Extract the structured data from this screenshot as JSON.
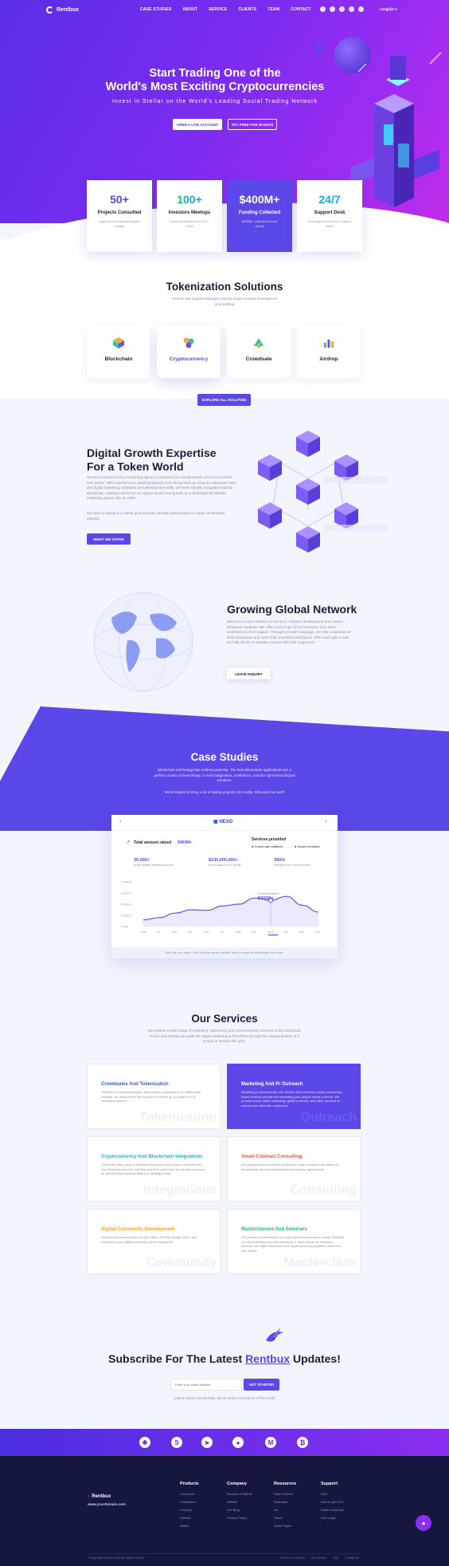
{
  "brand": {
    "name": "Rentbux"
  },
  "nav": {
    "items": [
      "CASE STUDIES",
      "ABOUT",
      "SERVICE",
      "CLIENTS",
      "TEAM",
      "CONTACT"
    ],
    "language": "English"
  },
  "hero": {
    "title_line1": "Start Trading One of the",
    "title_line2": "World's Most Exciting Cryptocurrencies",
    "subtitle": "Invest in Stellar on the World's Leading Social Trading Network",
    "btn_primary": "OPEN A LIVE ACCOUNT",
    "btn_secondary": "TRY FREE FOR 30-DAYS"
  },
  "stats": [
    {
      "value": "50+",
      "label": "Projects Consulted",
      "desc": "Apply for an expertise project review"
    },
    {
      "value": "100+",
      "label": "Investors Meetups",
      "desc": "Investors Meetups in 2017-2018"
    },
    {
      "value": "$400M+",
      "label": "Funding Collected",
      "desc": "$400M+ collected for our clients"
    },
    {
      "value": "24/7",
      "label": "Support Desk",
      "desc": "Full support 24 hours 7 days a week"
    }
  ],
  "tokenization": {
    "title": "Tokenization Solutions",
    "text": "All technical support packages include smart contract development and auditing",
    "items": [
      "Blockchain",
      "Cryptocurrency",
      "Crowdsale",
      "Airdrop"
    ],
    "button": "EXPLORE ALL SOLUTION"
  },
  "growth": {
    "title_line1": "Digital Growth Expertise",
    "title_line2": "For a Token World",
    "p1": "We are a cryptocurrency marketing agency constructed by entrepreneurs who know to build and market. With experience in growing Startups from the ground up using our advanced SEO and digital marketing strategies and development skills, we have robustly navigated towards Blockchain, Startups and ICO's to support launch and growth as a dedicated Blockchain marketing agency like no other.",
    "p2": "Our love of seeing our clients grow ensures ultimate performance in a time constrained industry.",
    "button": "WHAT WE OFFER"
  },
  "network": {
    "title": "Growing Global Network",
    "text": "We focus on pre-market ICO services, software development and custom Ethereum solutions. We offer a full scope of ICO services, from seed investment to ICO support. Throughout each campaign, we help companies to build awareness and reach their potential contributors. After each sale is over, we help clients to maintain contact with their supporters.",
    "button": "LEAVE INQUIRY"
  },
  "case_studies": {
    "title": "Case Studies",
    "text": "Blockchain technology has endless potential. The best Blockchain applications are a perfect combo of three things: A vivid imagination, confidence, and the right technological solutions.",
    "text2": "We've helped to bring a lot of daring projects into reality. Will yours be next?",
    "project": "NEXO",
    "card": {
      "total_label": "Total amount raised",
      "total_value": "$400M+",
      "services_label": "Services provided",
      "services": [
        "Crowd sale platform",
        "Smart contracts"
      ],
      "metrics": [
        {
          "value": "30,000+",
          "label": "active register investor accounts"
        },
        {
          "value": "$130,000,000+",
          "label": "funds raised by our clients"
        },
        {
          "value": "340%",
          "label": "average return on investment"
        }
      ],
      "tooltip_label": "Amount raised",
      "tooltip_value": "$400M+",
      "footer": "Don't sell your crypto. Don't lose the upside potential. Keep it and get an instant loan from Nexo."
    }
  },
  "chart_data": {
    "type": "area",
    "x": [
      "2016",
      "Jul",
      "Nov",
      "Apr",
      "2017",
      "Jul",
      "Sept",
      "Nov",
      "2018",
      "Jan",
      "Mar",
      "Oct"
    ],
    "yticks": [
      "$ 400 M",
      "$ 300 M",
      "$ 200 M",
      "$ 100 M",
      "$ 0 M"
    ],
    "ylim": [
      0,
      400
    ],
    "values": [
      60,
      80,
      120,
      150,
      145,
      185,
      200,
      255,
      235,
      270,
      190,
      130
    ]
  },
  "services": {
    "title": "Our Services",
    "text": "We provide a wide range of marketing, advertising and communication services in the blockchain sector and thereby we guide the digital marketing & PR efforts through the varying phases of a project or service life cycle.",
    "items": [
      {
        "title": "Crowdsales And Tokenization",
        "desc": "Whether it's concept analysis, token launch preparation, or white paper creation: we assist in the development of viable go-to projects for a successful launch.",
        "watermark": "Tokenization",
        "color": "#3a5ad9"
      },
      {
        "title": "Marketing And Pr Outreach",
        "desc": "Marketing is fundamental. Our service and extensive crypto community-based network provide the marketing your project needs to thrive. We provide social media marketing, global outreach, and other services to connect you best with customers.",
        "watermark": "Outreach",
        "color": "#ffffff"
      },
      {
        "title": "Cryptocurrency And Blockchain Integrations",
        "desc": "There are many ways to integrate blockchain and crypto currencies into your business process. We help you find a lead start on the new economy by defining and implementing your strategy today.",
        "watermark": "Integrations",
        "color": "#16b6c9"
      },
      {
        "title": "Smart Contract Consulting",
        "desc": "We analyze business needs to develop smart contract code based to decentralize financial transactions and service agreements.",
        "watermark": "Consulting",
        "color": "#e8563a"
      },
      {
        "title": "Digital Community Development",
        "desc": "Independent communities are the future. We help design, build, and implement your digital community to be trustworthy.",
        "watermark": "Community",
        "color": "#f0a32a"
      },
      {
        "title": "Masterclasses And Seminars",
        "desc": "We provide masterclasses on crypto-precious and block chains. Whether you are interested in public speaking or more hands on education process, we make blockchain and crypto currency programs tailored to your needs.",
        "watermark": "Masterclass",
        "color": "#2bb673"
      }
    ]
  },
  "subscribe": {
    "title_pre": "Subscribe For The Latest",
    "title_brand": "Rentbux",
    "title_post": "Updates!",
    "placeholder": "Enter your email address",
    "button": "GET STARTED",
    "note": "Latest news in blockchain, bitcoin and e-commerce of the world"
  },
  "footer": {
    "brand": "Rentbux",
    "url": "www.yourdomain.com",
    "columns": [
      {
        "title": "Products",
        "items": [
          "Consumer",
          "Commerce",
          "Custody",
          "Pamela",
          "Wallet"
        ]
      },
      {
        "title": "Company",
        "items": [
          "Become a Partner",
          "Affiliate",
          "Our Blog",
          "Privacy Policy"
        ]
      },
      {
        "title": "Resources",
        "items": [
          "How It Works",
          "Roadmap",
          "Ico",
          "Token",
          "White Paper"
        ]
      },
      {
        "title": "Support",
        "items": [
          "FAQ",
          "How to get ETH",
          "What is Airdrop?",
          "Give angel"
        ]
      }
    ],
    "copyright": "© Copyright Rentbux 2018. All rights reserved",
    "legal": [
      "Terms & Conditions",
      "Our Partners",
      "FAQ",
      "Contact Us"
    ]
  },
  "colors": {
    "brand": "#5a48e8",
    "hero_start": "#5b2ee6",
    "hero_end": "#c12de9",
    "footer_bg": "#15173f"
  }
}
